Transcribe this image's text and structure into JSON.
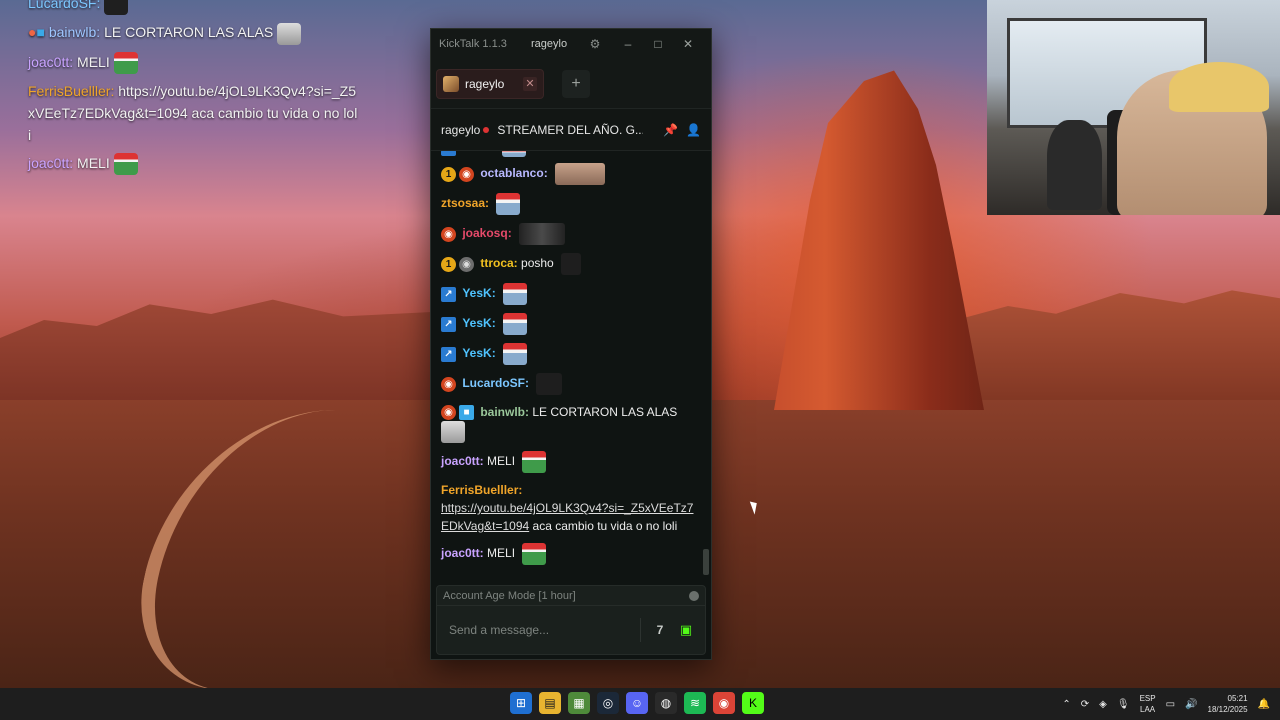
{
  "overlay_chat": [
    {
      "user": "LucardoSF:",
      "text": "",
      "color": "#7cc7ff"
    },
    {
      "user": "bainwlb:",
      "text": "LE CORTARON LAS ALAS",
      "color": "#9ec6ff"
    },
    {
      "user": "joac0tt:",
      "text": "MELI",
      "color": "#c9a3ff"
    },
    {
      "user": "FerrisBuelller:",
      "text": "https://youtu.be/4jOL9LK3Qv4?si=_Z5xVEeTz7EDkVag&t=1094 aca cambio tu vida o no loli",
      "color": "#f0a52a"
    },
    {
      "user": "joac0tt:",
      "text": "MELI",
      "color": "#c9a3ff"
    }
  ],
  "window": {
    "app_title": "KickTalk 1.1.3",
    "channel": "rageylo",
    "minimize": "–",
    "maximize": "□",
    "close": "✕"
  },
  "tabs": [
    {
      "label": "rageylo"
    }
  ],
  "add_tab": "+",
  "header": {
    "name": "rageylo",
    "title": "STREAMER DEL AÑO. G..."
  },
  "messages": [
    {
      "user": "octablanco:",
      "color": "#b9b9ff"
    },
    {
      "user": "ztsosaa:",
      "color": "#f0a52a"
    },
    {
      "user": "joakosq:",
      "color": "#e64a6a"
    },
    {
      "user": "ttroca:",
      "text": "posho",
      "color": "#f0c020"
    },
    {
      "user": "YesK:",
      "color": "#4fc3ff"
    },
    {
      "user": "YesK:",
      "color": "#4fc3ff"
    },
    {
      "user": "YesK:",
      "color": "#4fc3ff"
    },
    {
      "user": "LucardoSF:",
      "color": "#7cc7ff"
    },
    {
      "user": "bainwlb:",
      "text": "LE CORTARON LAS ALAS",
      "color": "#9ac79a"
    },
    {
      "user": "joac0tt:",
      "text": "MELI",
      "color": "#c9a3ff"
    },
    {
      "user": "FerrisBuelller:",
      "link": "https://youtu.be/4jOL9LK3Qv4?si=_Z5xVEeTz7EDkVag&t=1094",
      "text": "aca cambio tu vida o no loli",
      "color": "#f0a52a"
    },
    {
      "user": "joac0tt:",
      "text": "MELI",
      "color": "#c9a3ff"
    }
  ],
  "input": {
    "mode": "Account Age Mode [1 hour]",
    "placeholder": "Send a message..."
  },
  "taskbar": {
    "lang": "ESP",
    "lang2": "LAA",
    "time": "05:21",
    "date": "18/12/2025"
  },
  "colors": {
    "kick_green": "#53fc18",
    "window_bg": "#0f1412"
  }
}
